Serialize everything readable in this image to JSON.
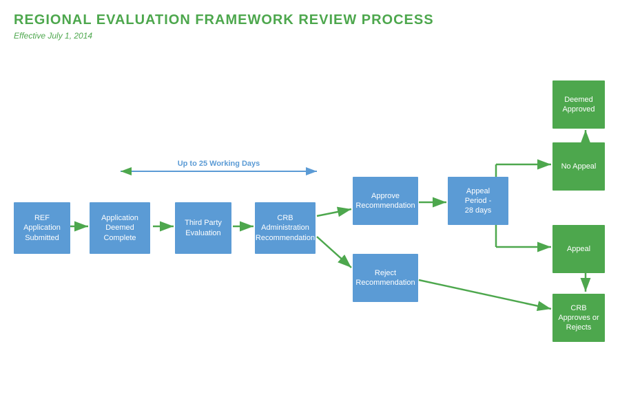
{
  "title": "REGIONAL EVALUATION FRAMEWORK REVIEW PROCESS",
  "subtitle": "Effective July 1, 2014",
  "boxes": {
    "ref_application": {
      "label": "REF\nApplication\nSubmitted"
    },
    "app_deemed": {
      "label": "Application\nDeemed\nComplete"
    },
    "third_party": {
      "label": "Third Party\nEvaluation"
    },
    "crb_admin": {
      "label": "CRB\nAdministration\nRecommendation"
    },
    "approve_rec": {
      "label": "Approve\nRecommendation"
    },
    "reject_rec": {
      "label": "Reject\nRecommendation"
    },
    "appeal_period": {
      "label": "Appeal\nPeriod -\n28 days"
    },
    "no_appeal": {
      "label": "No Appeal"
    },
    "appeal": {
      "label": "Appeal"
    },
    "deemed_approved": {
      "label": "Deemed\nApproved"
    },
    "crb_approves": {
      "label": "CRB\nApproves or\nRejects"
    }
  },
  "labels": {
    "working_days": "Up to 25 Working Days"
  },
  "colors": {
    "blue": "#5b9bd5",
    "green": "#4da74d",
    "green_arrow": "#4da74d",
    "blue_arrow": "#5b9bd5"
  }
}
